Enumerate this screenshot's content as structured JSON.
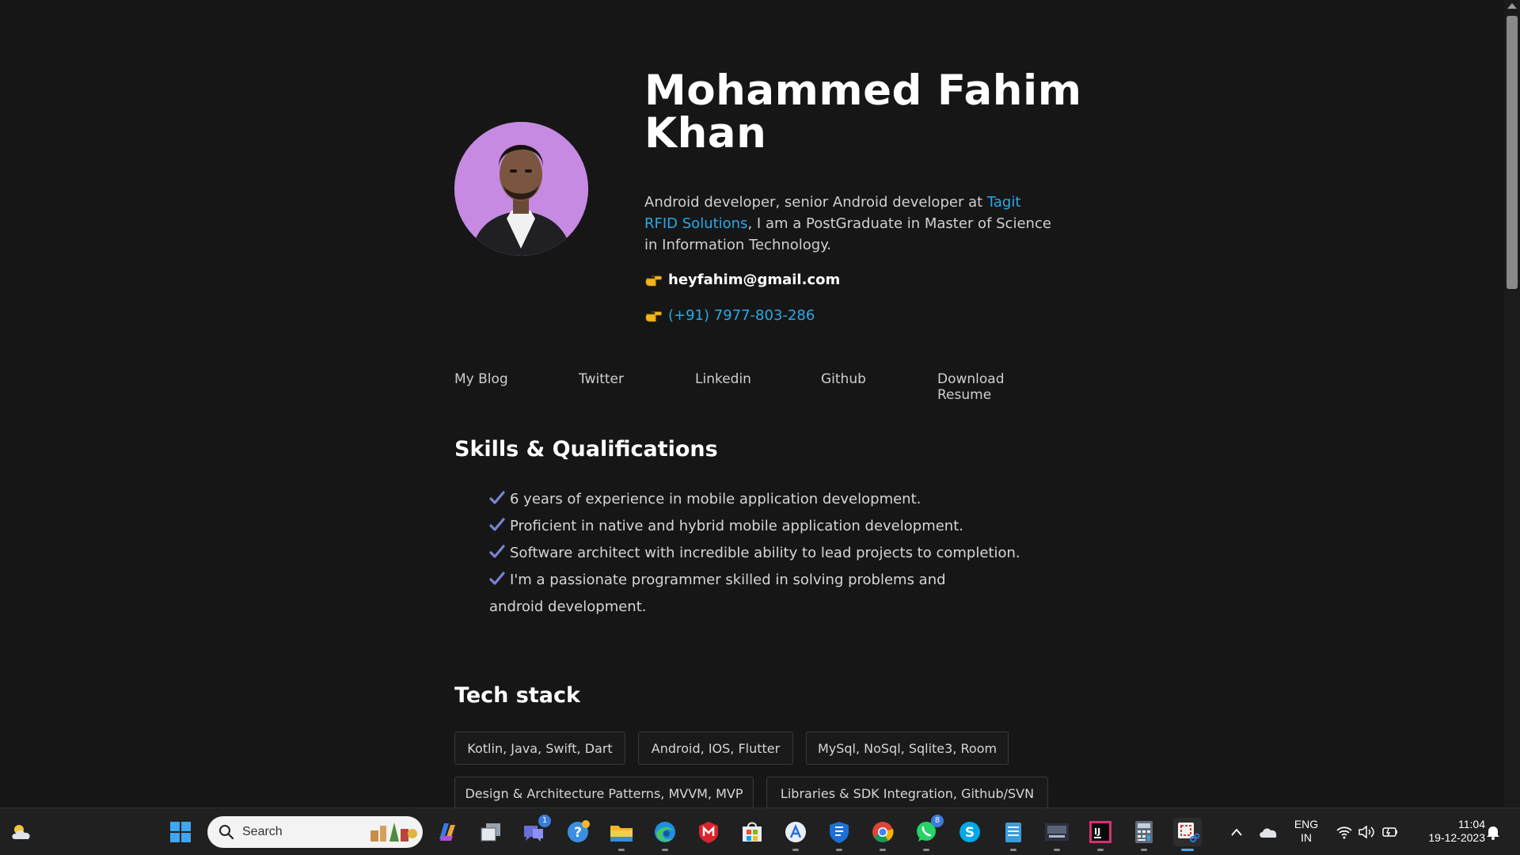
{
  "profile": {
    "name": "Mohammed Fahim Khan",
    "bio_prefix": "Android developer, senior Android developer at ",
    "bio_link": "Tagit RFID Solutions",
    "bio_suffix": ", I am a PostGraduate in Master of Science in Information Technology.",
    "email": "heyfahim@gmail.com",
    "phone": "(+91) 7977-803-286"
  },
  "nav": {
    "items": [
      "My Blog",
      "Twitter",
      "Linkedin",
      "Github",
      "Download Resume"
    ]
  },
  "skills": {
    "title": "Skills & Qualifications",
    "items": [
      "6 years of experience in mobile application development.",
      "Proficient in native and hybrid mobile application development.",
      "Software architect with incredible ability to lead projects to completion.",
      "I'm a passionate programmer skilled in solving problems and android development."
    ]
  },
  "tech": {
    "title": "Tech stack",
    "tags": [
      "Kotlin, Java, Swift, Dart",
      "Android, IOS, Flutter",
      "MySql, NoSql, Sqlite3, Room",
      "Design & Architecture Patterns, MVVM, MVP",
      "Libraries & SDK Integration, Github/SVN"
    ]
  },
  "taskbar": {
    "search_label": "Search",
    "language_line1": "ENG",
    "language_line2": "IN",
    "time": "11:04",
    "date": "19-12-2023",
    "teams_badge": "1",
    "whatsapp_badge": "8",
    "icons": [
      "weather-icon",
      "start-icon",
      "search-icon",
      "copilot-icon",
      "task-view-icon",
      "teams-icon",
      "tips-icon",
      "file-explorer-icon",
      "edge-icon",
      "mcafee-icon",
      "store-icon",
      "app-store-icon",
      "defender-icon",
      "chrome-icon",
      "whatsapp-icon",
      "skype-icon",
      "notepad-icon",
      "media-app-icon",
      "intellij-icon",
      "calculator-icon",
      "snipping-tool-icon",
      "chevron-up-icon",
      "onedrive-icon",
      "wifi-icon",
      "volume-icon",
      "battery-icon",
      "notification-bell-icon"
    ]
  },
  "colors": {
    "background": "#161616",
    "link": "#29a9e8",
    "check": "#7b83d6",
    "taskbar": "#202020"
  }
}
